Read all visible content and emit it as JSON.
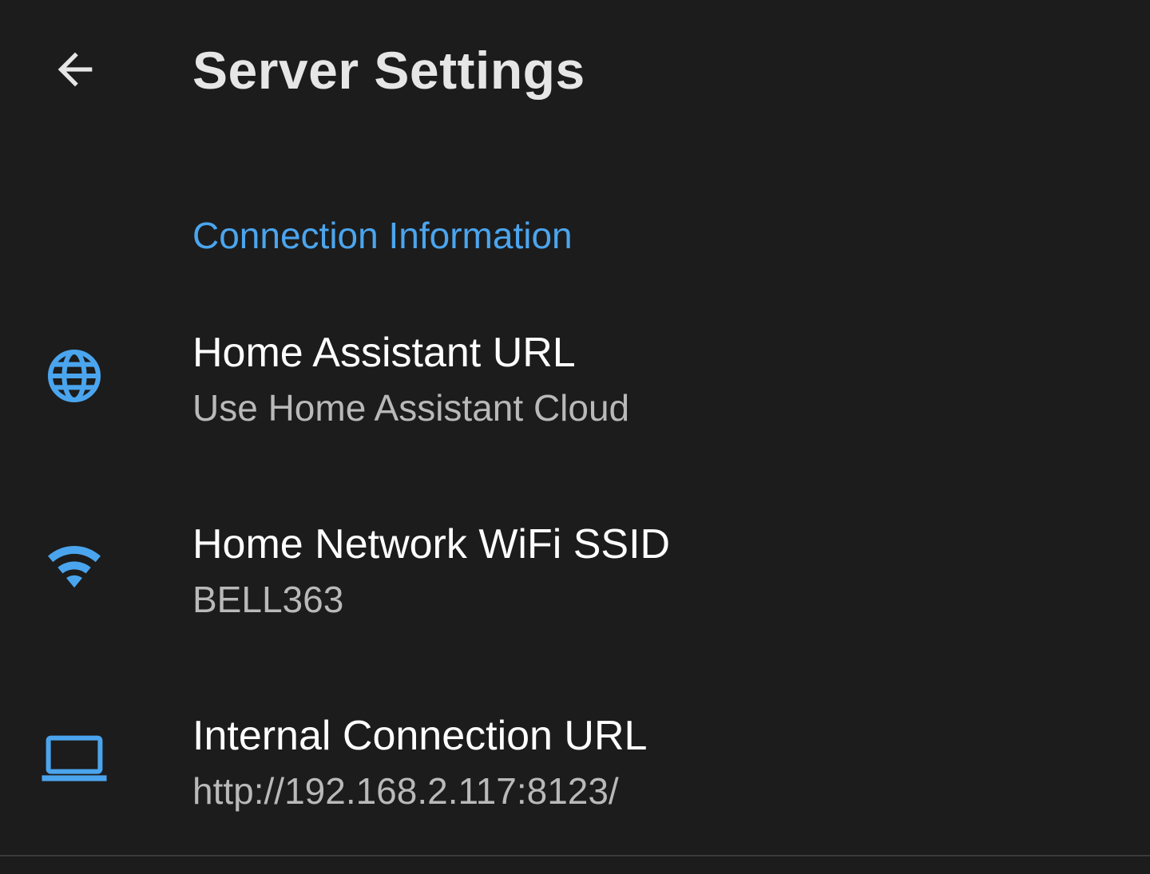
{
  "header": {
    "title": "Server Settings",
    "back_icon": "arrow-left-icon"
  },
  "section": {
    "title": "Connection Information"
  },
  "preferences": [
    {
      "icon": "globe-icon",
      "title": "Home Assistant URL",
      "summary": "Use Home Assistant Cloud"
    },
    {
      "icon": "wifi-icon",
      "title": "Home Network WiFi SSID",
      "summary": "BELL363"
    },
    {
      "icon": "laptop-icon",
      "title": "Internal Connection URL",
      "summary": "http://192.168.2.117:8123/"
    }
  ],
  "colors": {
    "background": "#1c1c1c",
    "accent": "#4ba5ee",
    "title_text": "#e6e6e6",
    "primary_text": "#ffffff",
    "secondary_text": "#b9b9b9"
  }
}
